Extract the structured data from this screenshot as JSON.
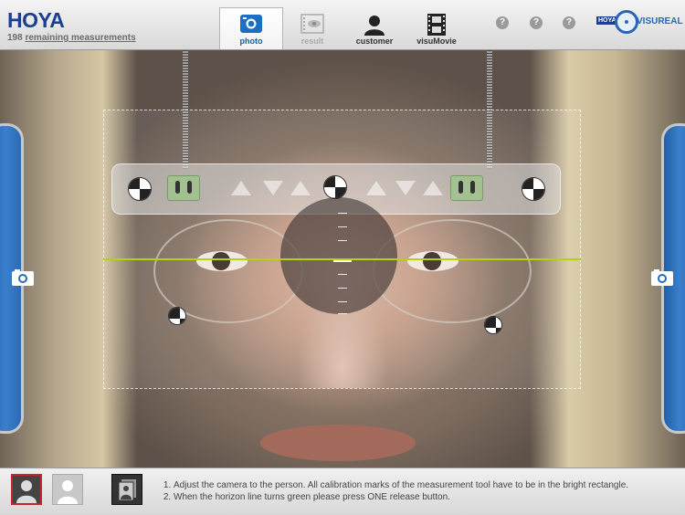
{
  "header": {
    "logo": "HOYA",
    "remaining_count": "198",
    "remaining_link": "remaining measurements",
    "tabs": [
      {
        "label": "photo",
        "state": "active"
      },
      {
        "label": "result",
        "state": "disabled"
      },
      {
        "label": "customer",
        "state": "normal"
      },
      {
        "label": "visuMovie",
        "state": "normal"
      }
    ],
    "help_buttons": [
      "?",
      "?",
      "?"
    ],
    "brand_small": "HOYA",
    "brand_name": "VISUREAL"
  },
  "camera": {
    "left_release_icon": "camera-icon",
    "right_release_icon": "camera-icon",
    "horizon_color": "#b3d312"
  },
  "footer": {
    "instructions": [
      "Adjust the camera to the person. All calibration marks of the measurement tool have to be in the bright rectangle.",
      "When the horizon line turns green please press ONE release button."
    ]
  },
  "colors": {
    "brand_blue": "#1b3f8f",
    "button_blue": "#2a6ab6",
    "selected_red": "#c6262a"
  }
}
